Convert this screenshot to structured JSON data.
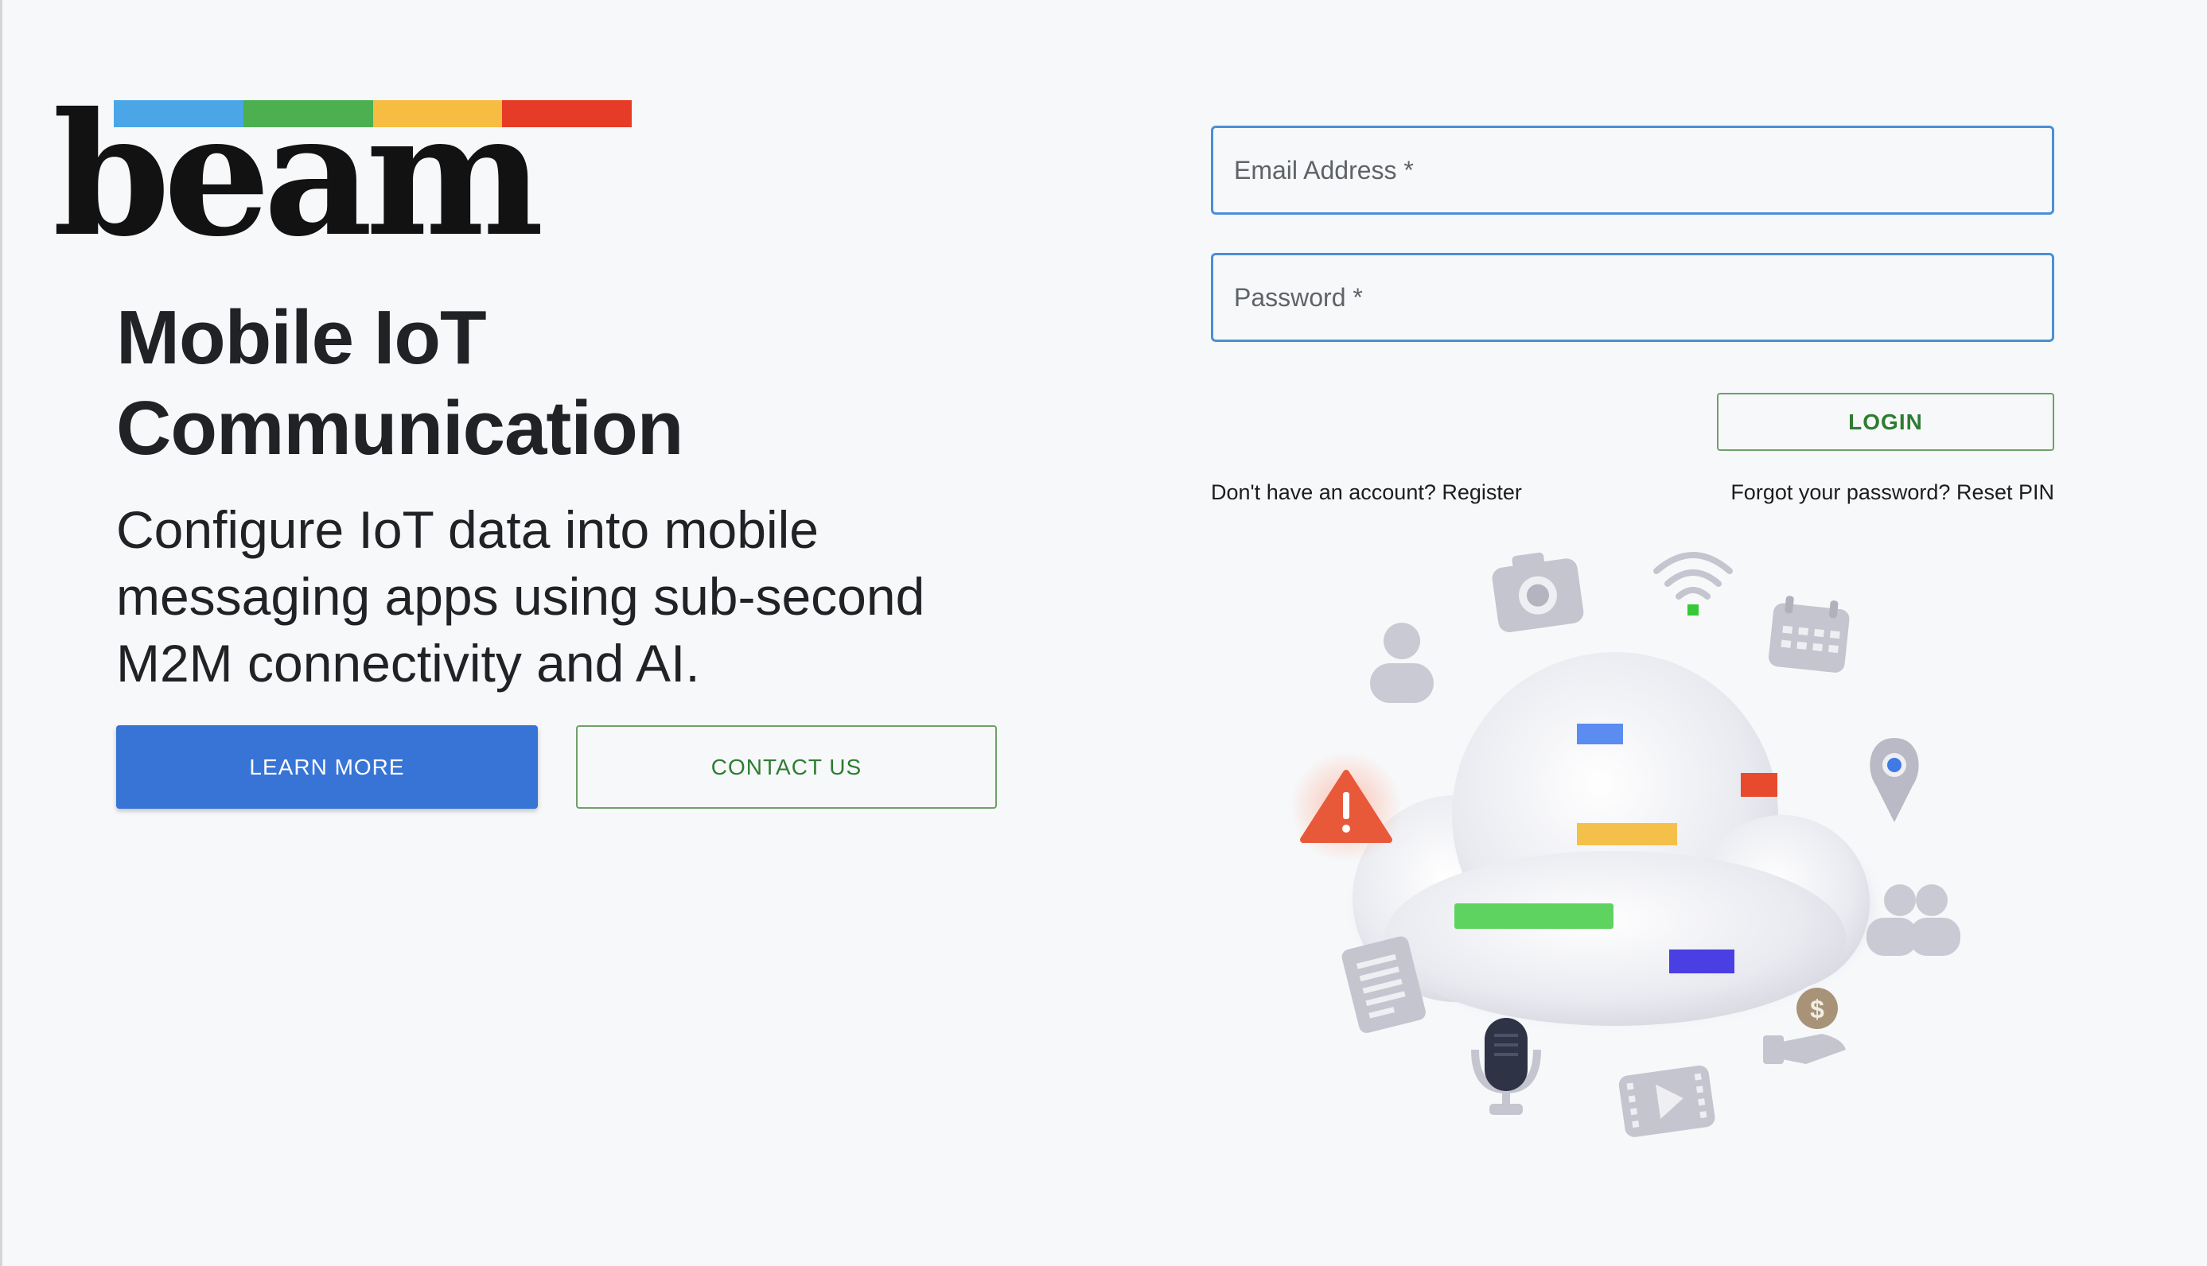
{
  "brand": {
    "logo_text": "beam",
    "bar_colors": [
      "#4aa6e6",
      "#4caf50",
      "#f6bd42",
      "#e63b26"
    ]
  },
  "hero": {
    "title_line1": "Mobile IoT",
    "title_line2": "Communication",
    "subtitle": "Configure IoT data into mobile messaging apps using sub-second M2M connectivity and AI.",
    "learn_more_label": "LEARN MORE",
    "contact_us_label": "CONTACT US"
  },
  "login_form": {
    "email_placeholder": "Email Address *",
    "email_value": "",
    "password_placeholder": "Password *",
    "password_value": "",
    "login_label": "LOGIN",
    "register_text": "Don't have an account? Register",
    "reset_text": "Forgot your password? Reset PIN"
  },
  "colors": {
    "primary": "#3874d5",
    "secondary_text": "#2e7d32",
    "field_border": "#4a8fd6",
    "background": "#f7f8fa"
  },
  "illustration": {
    "icons": [
      "person-icon",
      "camera-icon",
      "wifi-icon",
      "calendar-icon",
      "location-pin-icon",
      "warning-icon",
      "group-icon",
      "document-icon",
      "microphone-icon",
      "video-icon",
      "money-hand-icon"
    ]
  }
}
